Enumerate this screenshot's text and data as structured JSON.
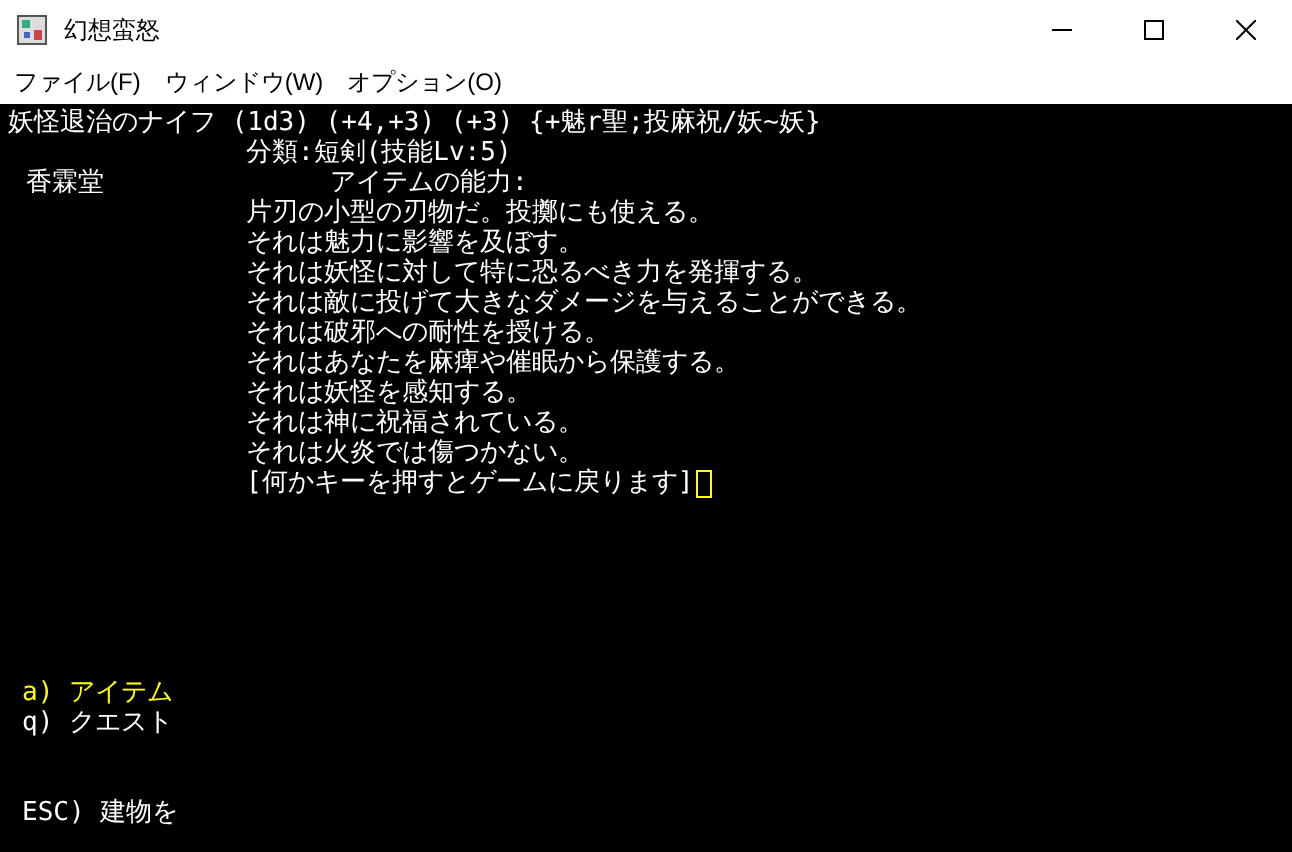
{
  "window": {
    "title": "幻想蛮怒"
  },
  "menu": [
    "ファイル(F)",
    "ウィンドウ(W)",
    "オプション(O)"
  ],
  "item_name": "妖怪退治のナイフ (1d3) (+4,+3) (+3) {+魅r聖;投麻祝/妖~妖}",
  "category": "分類:短剣(技能Lv:5)",
  "shop": "香霖堂",
  "abilities_heading": "アイテムの能力:",
  "description": [
    "片刃の小型の刃物だ。投擲にも使える。",
    "それは魅力に影響を及ぼす。",
    "それは妖怪に対して特に恐るべき力を発揮する。",
    "それは敵に投げて大きなダメージを与えることができる。",
    "それは破邪への耐性を授ける。",
    "それはあなたを麻痺や催眠から保護する。",
    "それは妖怪を感知する。",
    "それは神に祝福されている。",
    "それは火炎では傷つかない。"
  ],
  "prompt": "[何かキーを押すとゲームに戻ります]",
  "options": [
    {
      "label": "a) アイテム",
      "selected": true
    },
    {
      "label": "q) クエスト",
      "selected": false
    }
  ],
  "footer": "ESC) 建物を"
}
